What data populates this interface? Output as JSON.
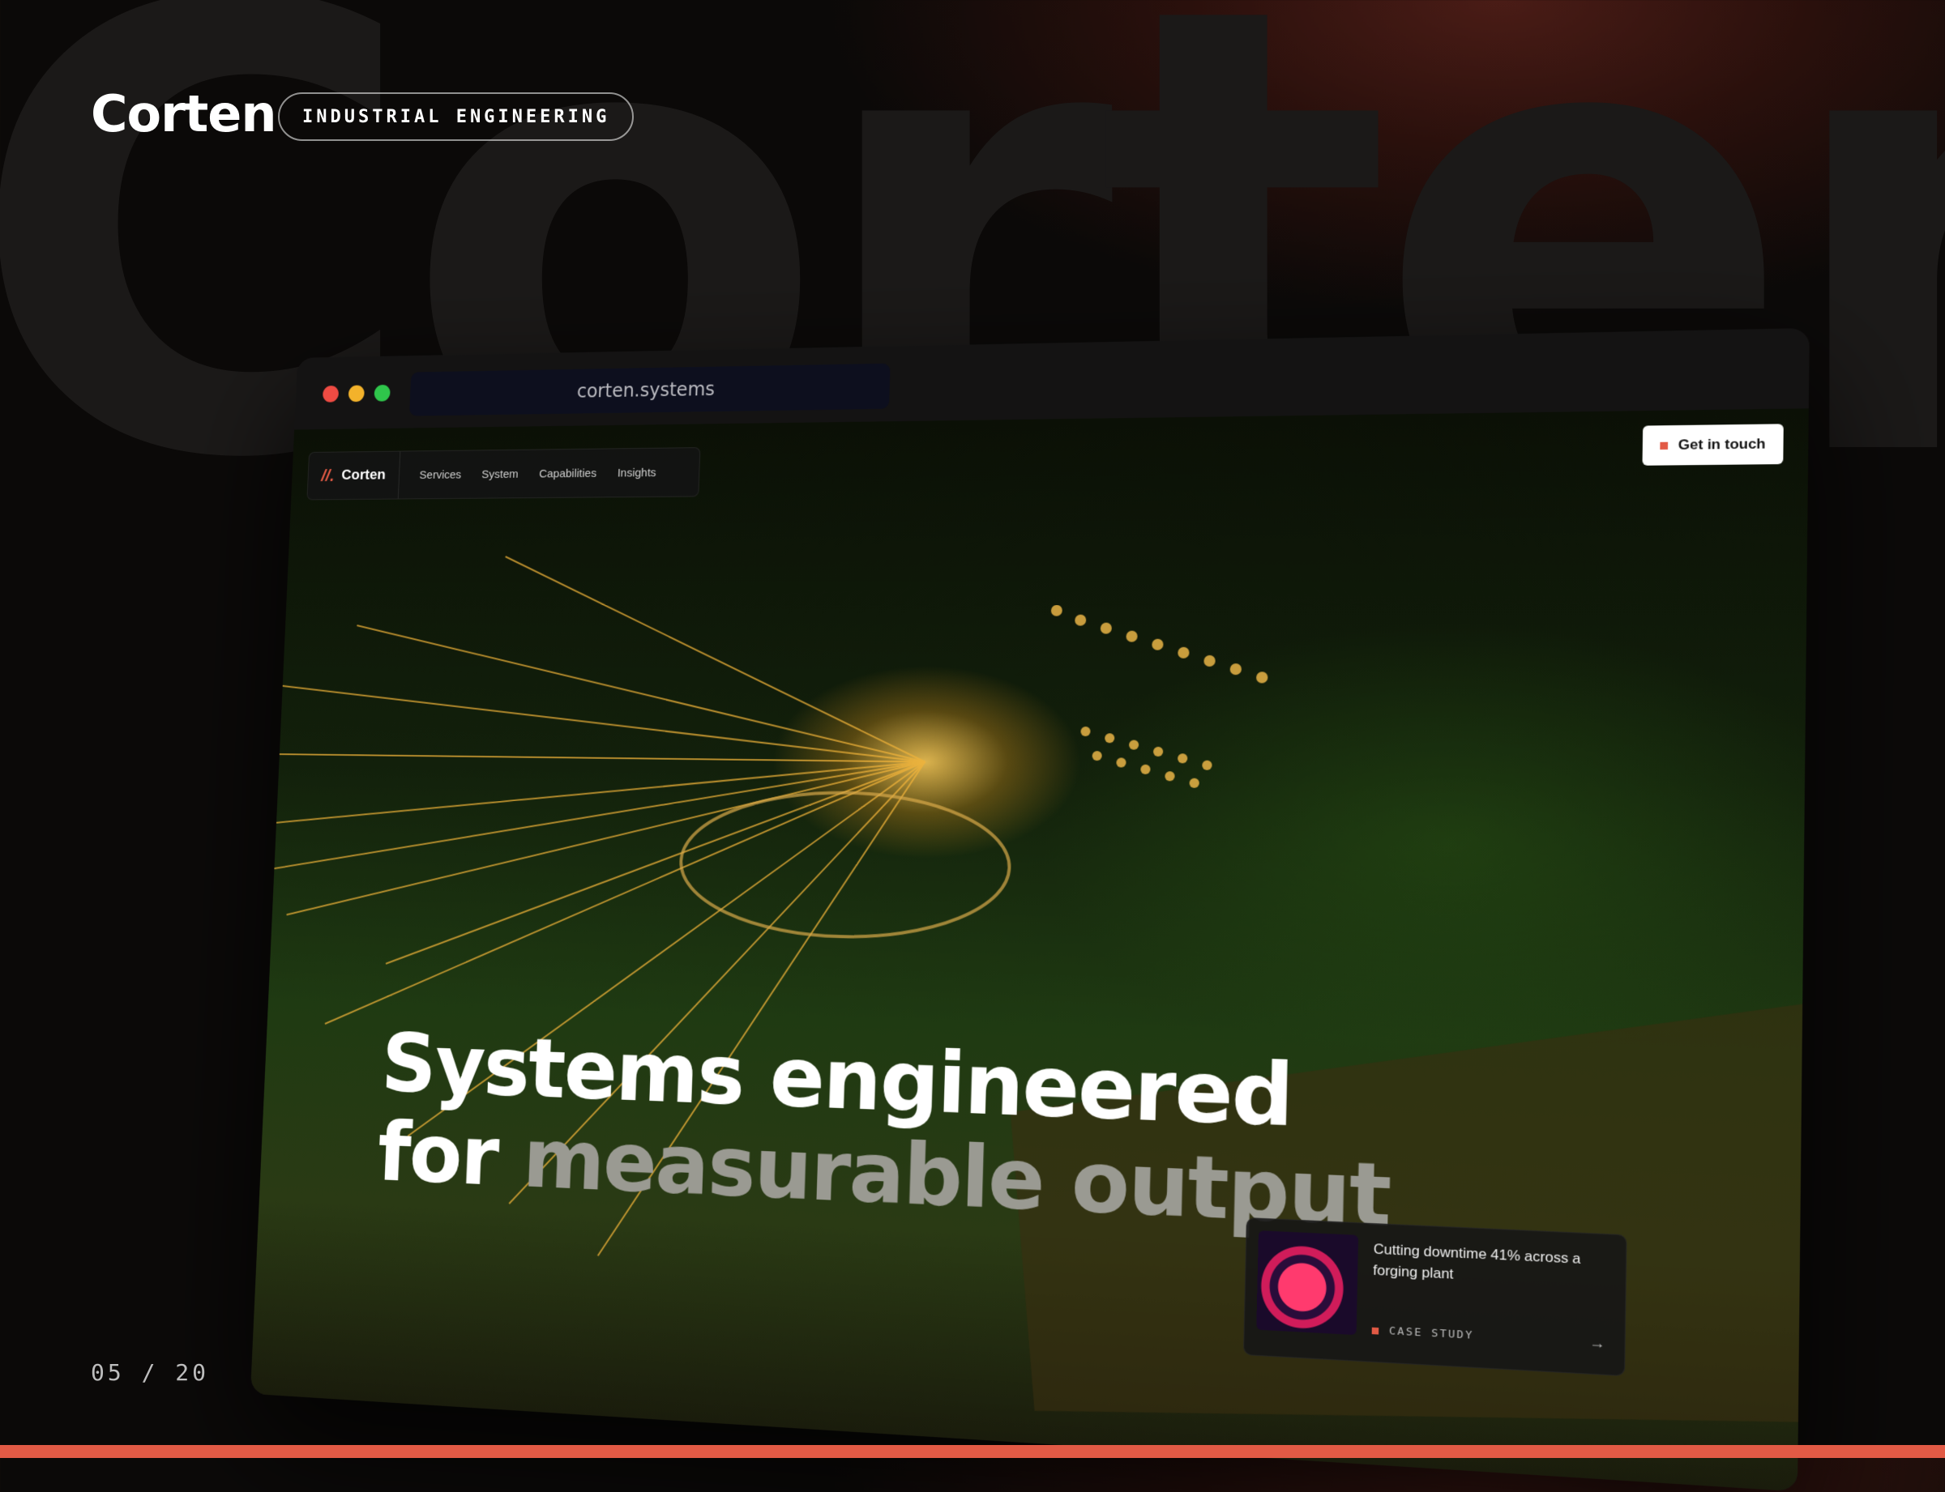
{
  "slide": {
    "bg_word": "Corten",
    "brand": "Corten",
    "tag": "INDUSTRIAL ENGINEERING",
    "pager": "05 / 20",
    "accent": "#e25a45"
  },
  "browser": {
    "url": "corten.systems",
    "traffic_lights": [
      "close",
      "minimize",
      "maximize"
    ]
  },
  "site": {
    "logo_mark": "//.",
    "logo_name": "Corten",
    "nav": [
      "Services",
      "System",
      "Capabilities",
      "Insights"
    ],
    "cta": "Get in touch",
    "headline_line1": "Systems engineered",
    "headline_for": "for",
    "headline_dim": "measurable output",
    "case_card": {
      "title": "Cutting downtime 41% across a forging plant",
      "tag": "CASE STUDY",
      "arrow": "→"
    }
  }
}
